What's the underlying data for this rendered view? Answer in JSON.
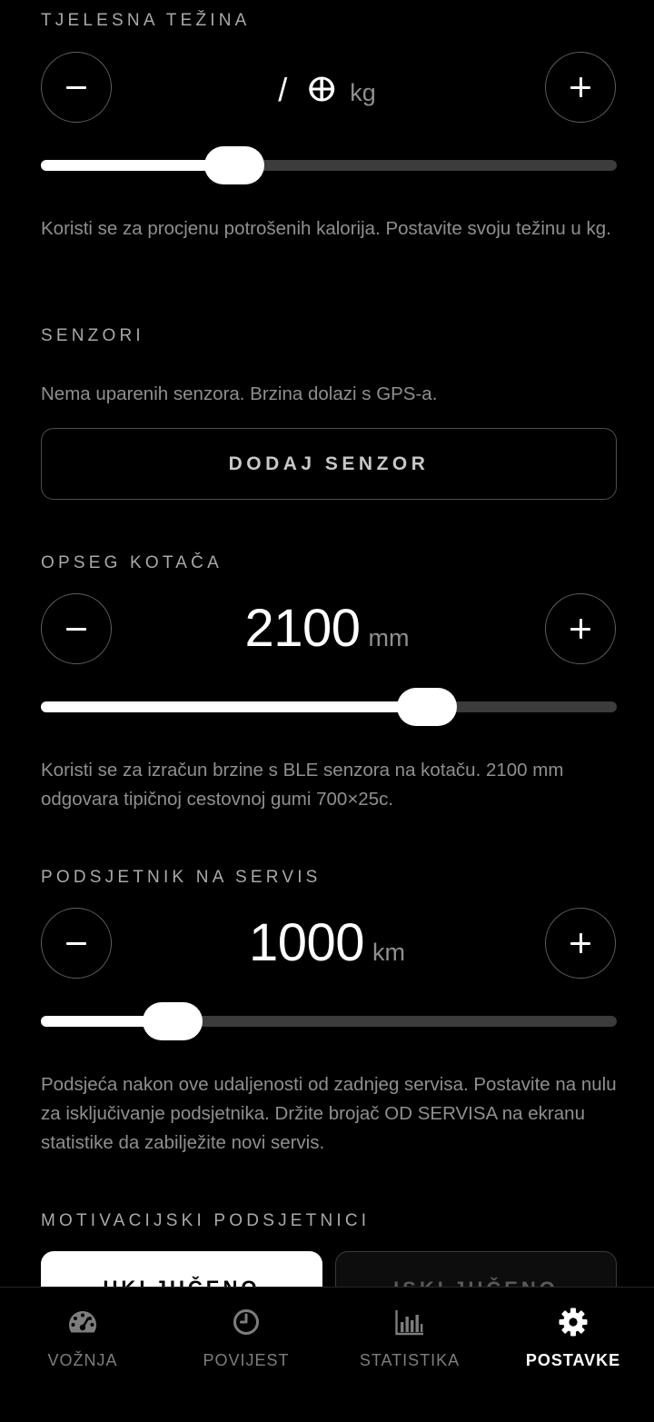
{
  "weight": {
    "title": "TJELESNA TEŽINA",
    "value": "/ ⴲ",
    "unit": "kg",
    "slider_fraction": 0.336,
    "description": "Koristi se za procjenu potrošenih kalorija. Postavite svoju težinu u kg."
  },
  "sensors": {
    "title": "SENZORI",
    "description": "Nema uparenih senzora. Brzina dolazi s GPS-a.",
    "add_button": "DODAJ SENZOR"
  },
  "wheel": {
    "title": "OPSEG KOTAČA",
    "value": "2100",
    "unit": "mm",
    "slider_fraction": 0.67,
    "description": "Koristi se za izračun brzine s BLE senzora na kotaču. 2100 mm odgovara tipičnoj cestovnoj gumi 700×25c."
  },
  "service": {
    "title": "PODSJETNIK NA SERVIS",
    "value": "1000",
    "unit": "km",
    "slider_fraction": 0.229,
    "description": "Podsjeća nakon ove udaljenosti od zadnjeg servisa. Postavite na nulu za isključivanje podsjetnika. Držite brojač OD SERVISA na ekranu statistike da zabilježite novi servis."
  },
  "motivation": {
    "title": "MOTIVACIJSKI PODSJETNICI",
    "on_label": "UKLJUČENO",
    "off_label": "ISKLJUČENO"
  },
  "tabs": [
    {
      "label": "VOŽNJA",
      "icon": "speedometer-icon",
      "active": false
    },
    {
      "label": "POVIJEST",
      "icon": "clock-icon",
      "active": false
    },
    {
      "label": "STATISTIKA",
      "icon": "bar-chart-icon",
      "active": false
    },
    {
      "label": "POSTAVKE",
      "icon": "gear-icon",
      "active": true
    }
  ],
  "colors": {
    "background": "#000000",
    "accent": "#ffffff",
    "muted_text": "#8f8f8f",
    "track": "#3c3c3c"
  }
}
